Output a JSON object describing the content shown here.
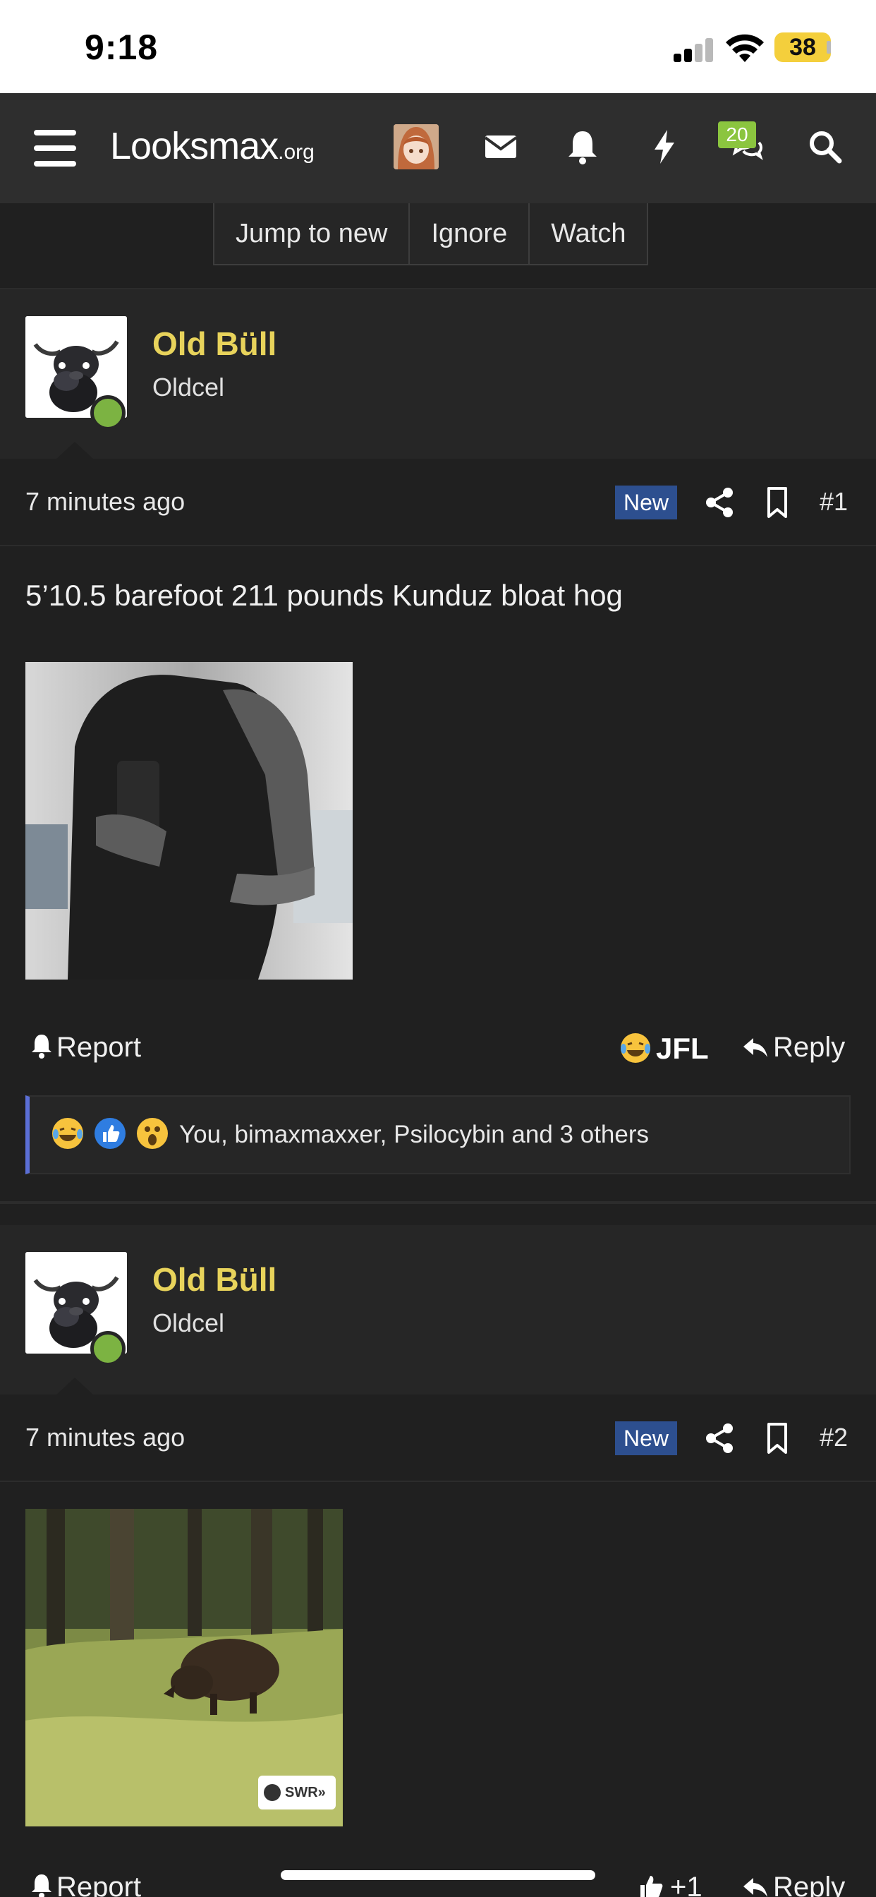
{
  "status_bar": {
    "time": "9:18",
    "battery": "38"
  },
  "nav": {
    "logo_main": "Looksmax",
    "logo_suffix": ".org",
    "notifications_badge": "20"
  },
  "thread_actions": {
    "jump": "Jump to new",
    "ignore": "Ignore",
    "watch": "Watch"
  },
  "posts": [
    {
      "username": "Old Büll",
      "user_title": "Oldcel",
      "time": "7 minutes ago",
      "new_label": "New",
      "number": "#1",
      "text": "5’10.5 barefoot 211 pounds Kunduz bloat hog",
      "report": "Report",
      "reaction_button": "JFL",
      "reply": "Reply",
      "reactions_summary": "You, bimaxmaxxer, Psilocybin and 3 others"
    },
    {
      "username": "Old Büll",
      "user_title": "Oldcel",
      "time": "7 minutes ago",
      "new_label": "New",
      "number": "#2",
      "image_watermark": "SWR»",
      "report": "Report",
      "like_label": "+1",
      "reply": "Reply"
    }
  ],
  "colors": {
    "accent_username": "#e8d35b",
    "new_badge": "#2d4f8f",
    "online": "#7cb342",
    "reactions_border": "#5b6fd6",
    "badge_green": "#8bc53f"
  }
}
